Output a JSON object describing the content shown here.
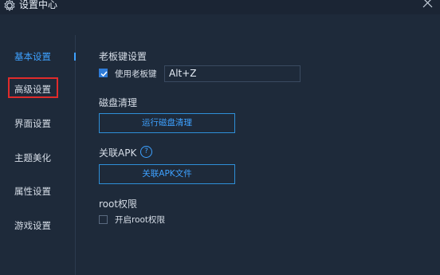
{
  "window": {
    "title": "设置中心"
  },
  "sidebar": {
    "items": [
      {
        "label": "基本设置"
      },
      {
        "label": "高级设置"
      },
      {
        "label": "界面设置"
      },
      {
        "label": "主题美化"
      },
      {
        "label": "属性设置"
      },
      {
        "label": "游戏设置"
      }
    ]
  },
  "boss_key": {
    "title": "老板键设置",
    "checkbox_label": "使用老板键",
    "checked": true,
    "hotkey_value": "Alt+Z"
  },
  "disk_cleanup": {
    "title": "磁盘清理",
    "button_label": "运行磁盘清理"
  },
  "apk_assoc": {
    "title": "关联APK",
    "help_icon": "?",
    "button_label": "关联APK文件"
  },
  "root": {
    "title": "root权限",
    "checkbox_label": "开启root权限",
    "checked": false
  },
  "colors": {
    "background": "#1e2a3a",
    "accent": "#3ea1ff",
    "highlight_box": "#e02b2b"
  }
}
